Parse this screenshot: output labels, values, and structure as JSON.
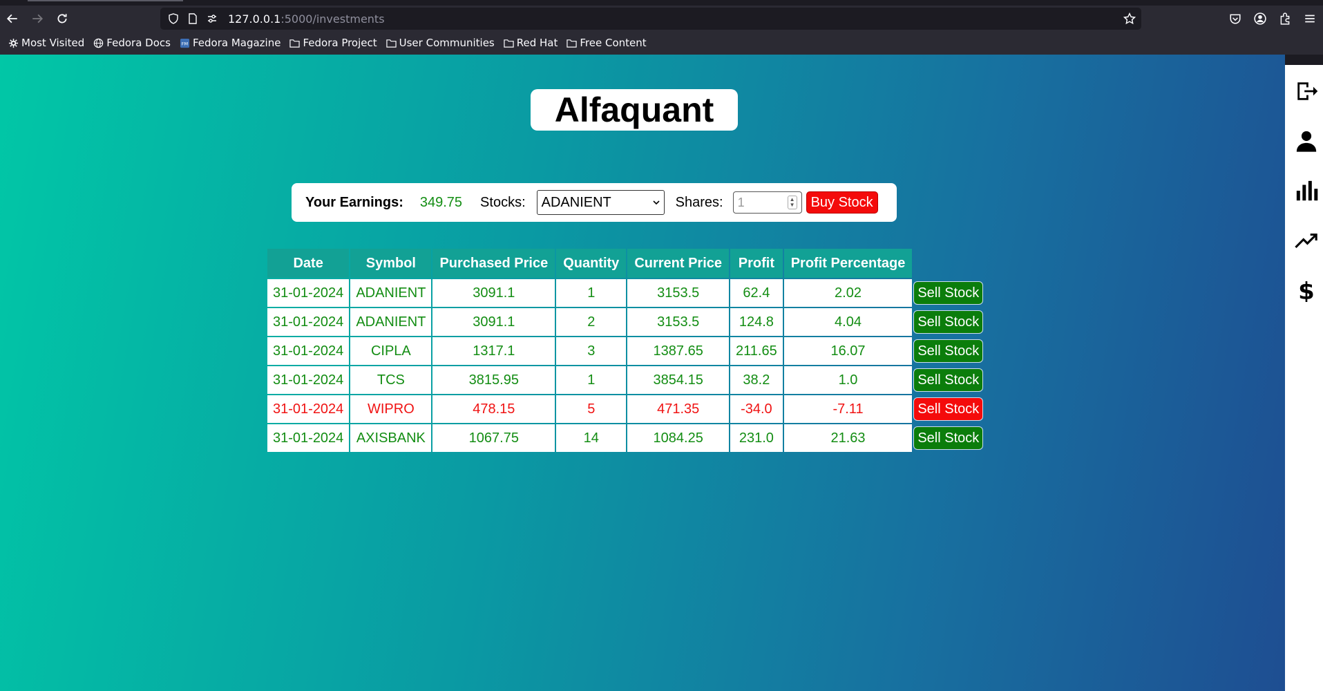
{
  "browser": {
    "url_host": "127.0.0.1",
    "url_path": ":5000/investments",
    "bookmarks": [
      "Most Visited",
      "Fedora Docs",
      "Fedora Magazine",
      "Fedora Project",
      "User Communities",
      "Red Hat",
      "Free Content"
    ]
  },
  "app": {
    "brand": "Alfaquant"
  },
  "buybar": {
    "earnings_label": "Your Earnings:",
    "earnings_value": "349.75",
    "stocks_label": "Stocks:",
    "selected_stock": "ADANIENT",
    "shares_label": "Shares:",
    "shares_placeholder": "1",
    "buy_label": "Buy Stock"
  },
  "table": {
    "headers": [
      "Date",
      "Symbol",
      "Purchased Price",
      "Quantity",
      "Current Price",
      "Profit",
      "Profit Percentage"
    ],
    "rows": [
      {
        "date": "31-01-2024",
        "symbol": "ADANIENT",
        "purchased": "3091.1",
        "qty": "1",
        "current": "3153.5",
        "profit": "62.4",
        "pct": "2.02",
        "sell": "Sell Stock",
        "status": "gain"
      },
      {
        "date": "31-01-2024",
        "symbol": "ADANIENT",
        "purchased": "3091.1",
        "qty": "2",
        "current": "3153.5",
        "profit": "124.8",
        "pct": "4.04",
        "sell": "Sell Stock",
        "status": "gain"
      },
      {
        "date": "31-01-2024",
        "symbol": "CIPLA",
        "purchased": "1317.1",
        "qty": "3",
        "current": "1387.65",
        "profit": "211.65",
        "pct": "16.07",
        "sell": "Sell Stock",
        "status": "gain"
      },
      {
        "date": "31-01-2024",
        "symbol": "TCS",
        "purchased": "3815.95",
        "qty": "1",
        "current": "3854.15",
        "profit": "38.2",
        "pct": "1.0",
        "sell": "Sell Stock",
        "status": "gain"
      },
      {
        "date": "31-01-2024",
        "symbol": "WIPRO",
        "purchased": "478.15",
        "qty": "5",
        "current": "471.35",
        "profit": "-34.0",
        "pct": "-7.11",
        "sell": "Sell Stock",
        "status": "loss"
      },
      {
        "date": "31-01-2024",
        "symbol": "AXISBANK",
        "purchased": "1067.75",
        "qty": "14",
        "current": "1084.25",
        "profit": "231.0",
        "pct": "21.63",
        "sell": "Sell Stock",
        "status": "gain"
      }
    ]
  },
  "sidebar_icons": [
    "logout-icon",
    "user-icon",
    "bar-chart-icon",
    "trending-up-icon",
    "dollar-icon"
  ],
  "colors": {
    "gain": "#138d13",
    "loss": "#f01313",
    "header": "#12a195"
  }
}
